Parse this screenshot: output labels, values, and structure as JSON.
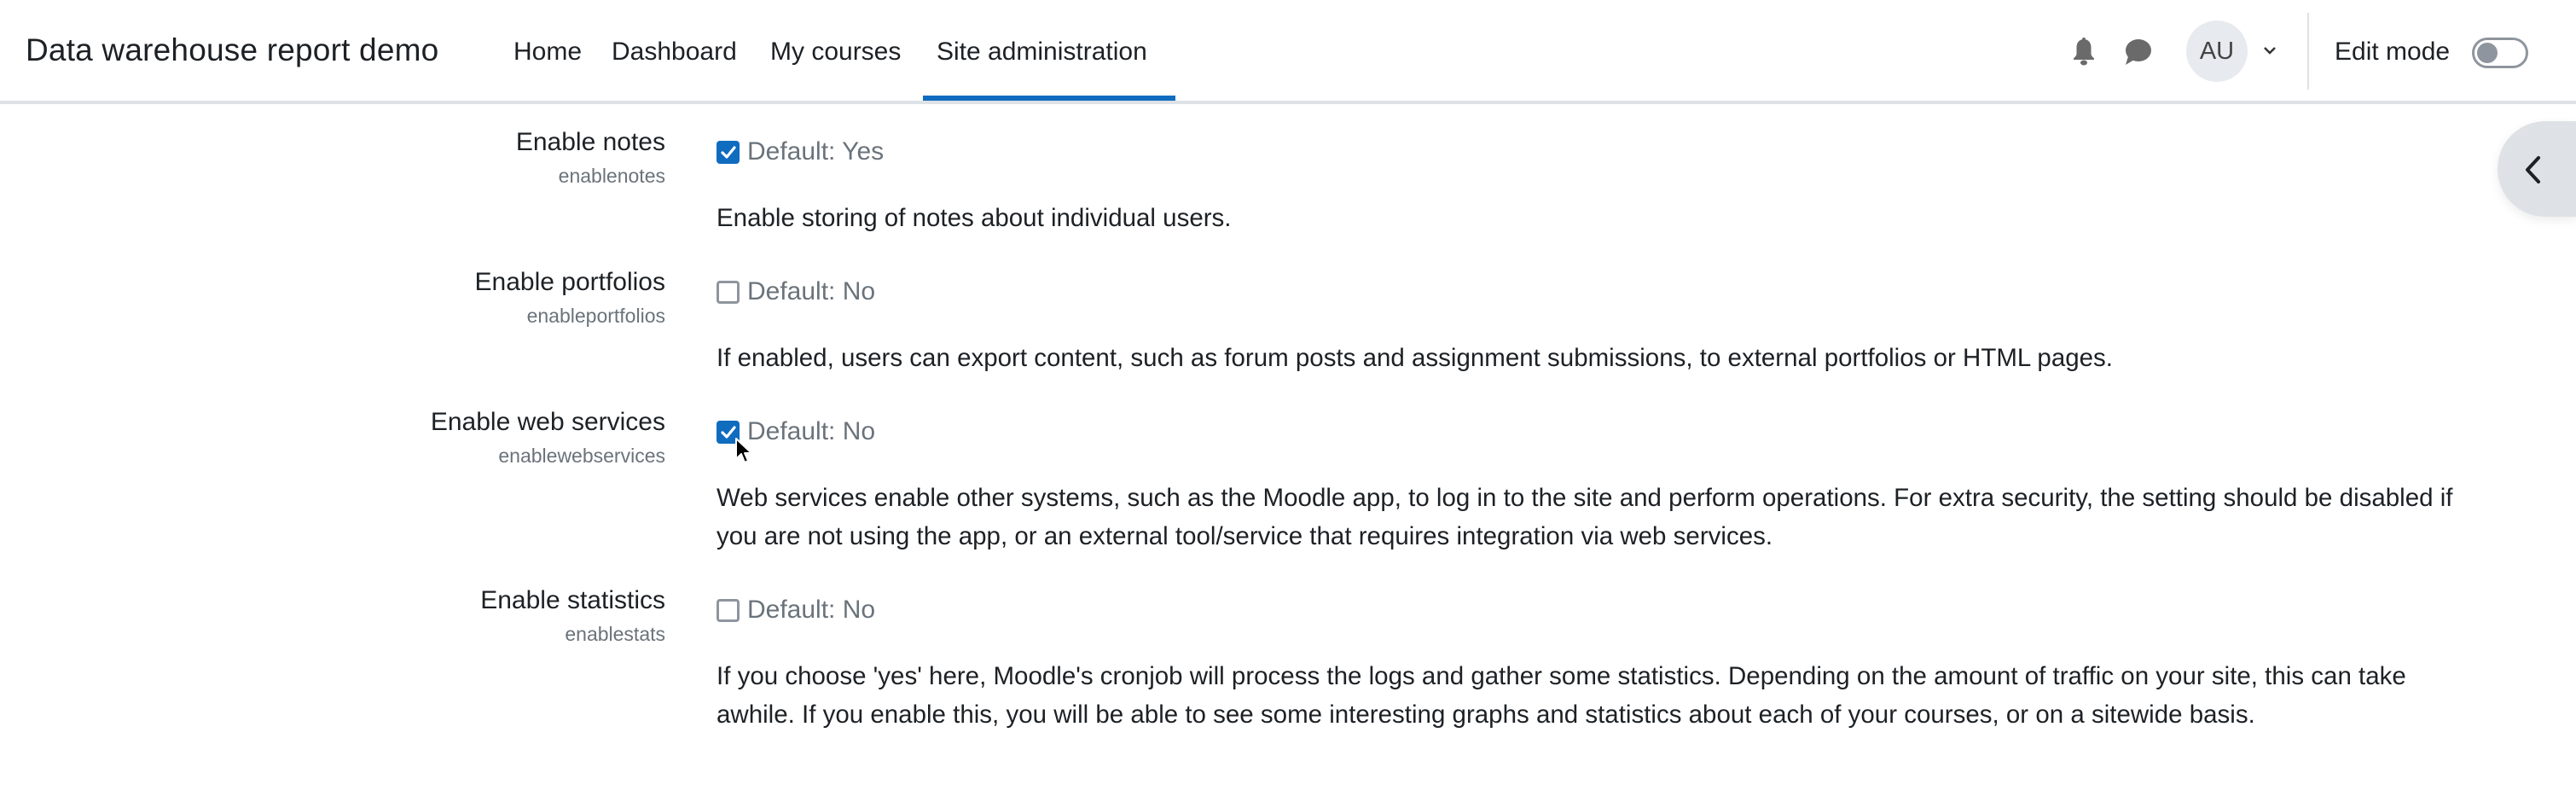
{
  "navbar": {
    "brand": "Data warehouse report demo",
    "items": [
      {
        "label": "Home",
        "active": false
      },
      {
        "label": "Dashboard",
        "active": false
      },
      {
        "label": "My courses",
        "active": false
      },
      {
        "label": "Site administration",
        "active": true
      }
    ],
    "avatar_initials": "AU",
    "edit_mode_label": "Edit mode",
    "edit_mode_on": false,
    "accent_color": "#0f6cbf",
    "icons": [
      "bell-icon",
      "chat-icon",
      "chevron-down-icon",
      "chevron-left-icon"
    ]
  },
  "settings": [
    {
      "label": "Enable notes",
      "key": "enablenotes",
      "checked": true,
      "default_text": "Default: Yes",
      "description": "Enable storing of notes about individual users."
    },
    {
      "label": "Enable portfolios",
      "key": "enableportfolios",
      "checked": false,
      "default_text": "Default: No",
      "description": "If enabled, users can export content, such as forum posts and assignment submissions, to external portfolios or HTML pages."
    },
    {
      "label": "Enable web services",
      "key": "enablewebservices",
      "checked": true,
      "default_text": "Default: No",
      "description": "Web services enable other systems, such as the Moodle app, to log in to the site and perform operations. For extra security, the setting should be disabled if you are not using the app, or an external tool/service that requires integration via web services."
    },
    {
      "label": "Enable statistics",
      "key": "enablestats",
      "checked": false,
      "default_text": "Default: No",
      "description": "If you choose 'yes' here, Moodle's cronjob will process the logs and gather some statistics. Depending on the amount of traffic on your site, this can take awhile. If you enable this, you will be able to see some interesting graphs and statistics about each of your courses, or on a sitewide basis."
    }
  ]
}
